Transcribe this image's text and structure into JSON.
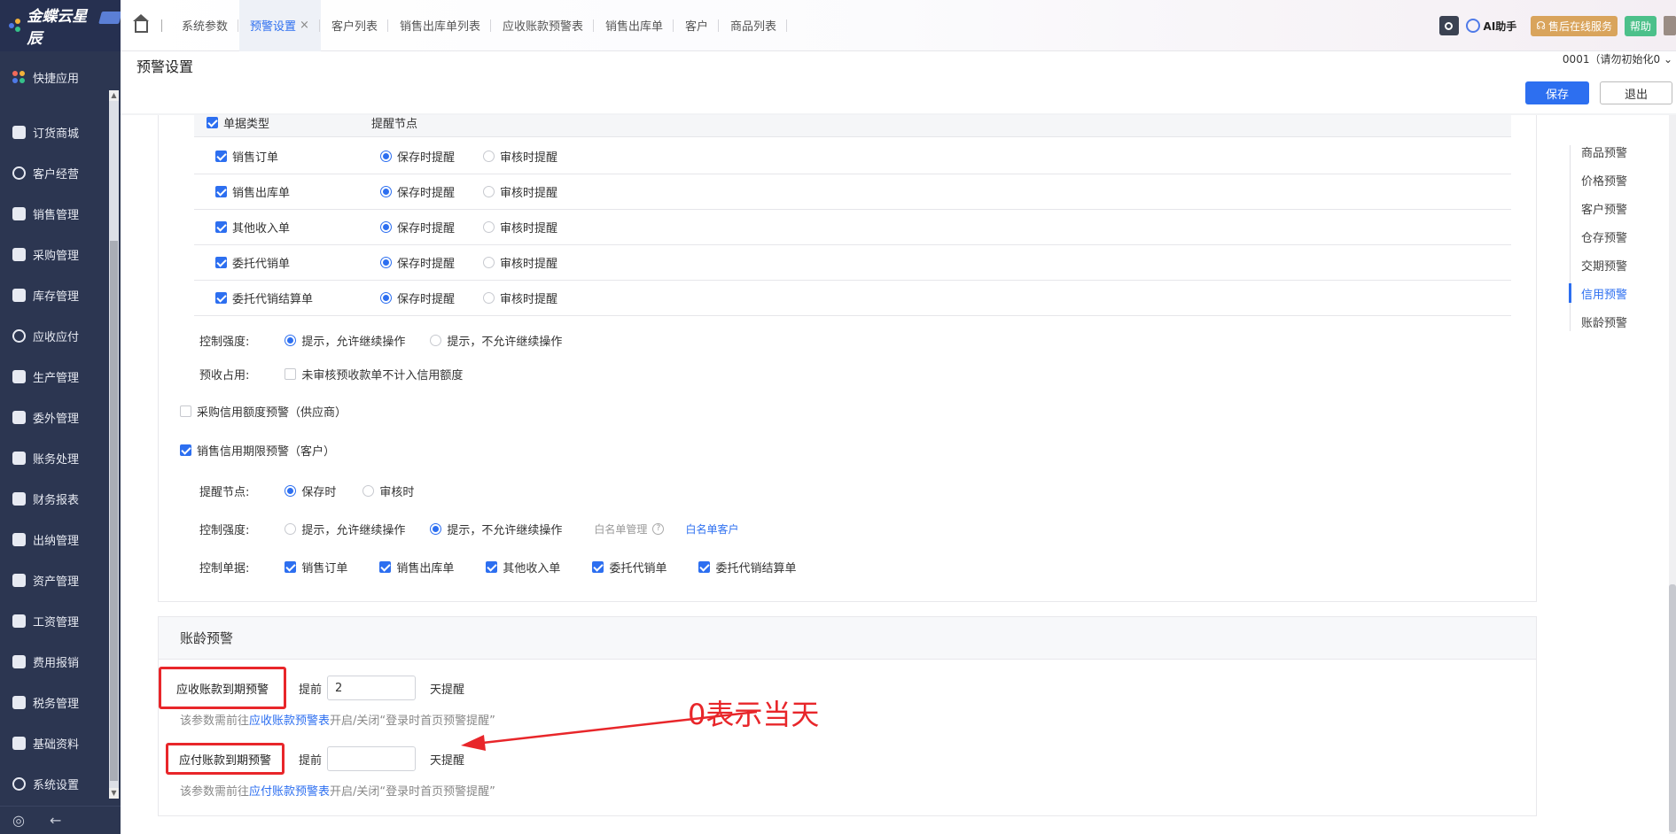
{
  "brand": {
    "name": "金蝶云星辰"
  },
  "sidebar": {
    "items": [
      {
        "label": "快捷应用",
        "icon": "apps-icon"
      },
      {
        "label": "订货商城",
        "icon": "bag-icon"
      },
      {
        "label": "客户经营",
        "icon": "user-icon"
      },
      {
        "label": "销售管理",
        "icon": "chart-icon"
      },
      {
        "label": "采购管理",
        "icon": "cart-icon"
      },
      {
        "label": "库存管理",
        "icon": "box-icon"
      },
      {
        "label": "应收应付",
        "icon": "exchange-icon"
      },
      {
        "label": "生产管理",
        "icon": "factory-icon"
      },
      {
        "label": "委外管理",
        "icon": "outsource-icon"
      },
      {
        "label": "账务处理",
        "icon": "ledger-icon"
      },
      {
        "label": "财务报表",
        "icon": "report-icon"
      },
      {
        "label": "出纳管理",
        "icon": "cashier-icon"
      },
      {
        "label": "资产管理",
        "icon": "asset-icon"
      },
      {
        "label": "工资管理",
        "icon": "salary-icon"
      },
      {
        "label": "费用报销",
        "icon": "expense-icon"
      },
      {
        "label": "税务管理",
        "icon": "tax-icon"
      },
      {
        "label": "基础资料",
        "icon": "layers-icon"
      },
      {
        "label": "系统设置",
        "icon": "settings-icon"
      }
    ]
  },
  "tabs": [
    {
      "label": "系统参数"
    },
    {
      "label": "预警设置",
      "active": true
    },
    {
      "label": "客户列表"
    },
    {
      "label": "销售出库单列表"
    },
    {
      "label": "应收账款预警表"
    },
    {
      "label": "销售出库单"
    },
    {
      "label": "客户"
    },
    {
      "label": "商品列表"
    }
  ],
  "topbar": {
    "ai_label": "AI助手",
    "service_label": "售后在线服务",
    "help_label": "帮助"
  },
  "header": {
    "title": "预警设置",
    "org": "0001（请勿初始化0",
    "save_label": "保存",
    "exit_label": "退出"
  },
  "doc_table": {
    "col_type": "单据类型",
    "col_node": "提醒节点",
    "rows": [
      {
        "name": "销售订单",
        "opt1": "保存时提醒",
        "opt2": "审核时提醒"
      },
      {
        "name": "销售出库单",
        "opt1": "保存时提醒",
        "opt2": "审核时提醒"
      },
      {
        "name": "其他收入单",
        "opt1": "保存时提醒",
        "opt2": "审核时提醒"
      },
      {
        "name": "委托代销单",
        "opt1": "保存时提醒",
        "opt2": "审核时提醒"
      },
      {
        "name": "委托代销结算单",
        "opt1": "保存时提醒",
        "opt2": "审核时提醒"
      }
    ]
  },
  "credit": {
    "control_label": "控制强度:",
    "control_opt1": "提示，允许继续操作",
    "control_opt2": "提示，不允许继续操作",
    "prepay_label": "预收占用:",
    "prepay_opt": "未审核预收款单不计入信用额度",
    "purchase_credit": "采购信用额度预警（供应商）",
    "sales_period": "销售信用期限预警（客户）",
    "node_label": "提醒节点:",
    "node_opt1": "保存时",
    "node_opt2": "审核时",
    "control2_label": "控制强度:",
    "control2_opt1": "提示，允许继续操作",
    "control2_opt2": "提示，不允许继续操作",
    "whitelist_mgmt": "白名单管理",
    "whitelist_customer": "白名单客户",
    "docs_label": "控制单据:",
    "docs": [
      "销售订单",
      "销售出库单",
      "其他收入单",
      "委托代销单",
      "委托代销结算单"
    ]
  },
  "aging": {
    "title": "账龄预警",
    "ar_label": "应收账款到期预警",
    "ar_before": "提前",
    "ar_value": "2",
    "ar_after": "天提醒",
    "ar_hint_pre": "该参数需前往",
    "ar_hint_link": "应收账款预警表",
    "ar_hint_post": "开启/关闭“登录时首页预警提醒”",
    "ap_label": "应付账款到期预警",
    "ap_before": "提前",
    "ap_value": "",
    "ap_after": "天提醒",
    "ap_hint_pre": "该参数需前往",
    "ap_hint_link": "应付账款预警表",
    "ap_hint_post": "开启/关闭“登录时首页预警提醒”"
  },
  "annotation": "0表示当天",
  "anchors": [
    {
      "label": "商品预警"
    },
    {
      "label": "价格预警"
    },
    {
      "label": "客户预警"
    },
    {
      "label": "仓存预警"
    },
    {
      "label": "交期预警"
    },
    {
      "label": "信用预警",
      "active": true
    },
    {
      "label": "账龄预警"
    }
  ],
  "colors": {
    "accent": "#2d6ff0",
    "annotation": "#e8262a",
    "sidebar_bg": "#2c3651"
  }
}
